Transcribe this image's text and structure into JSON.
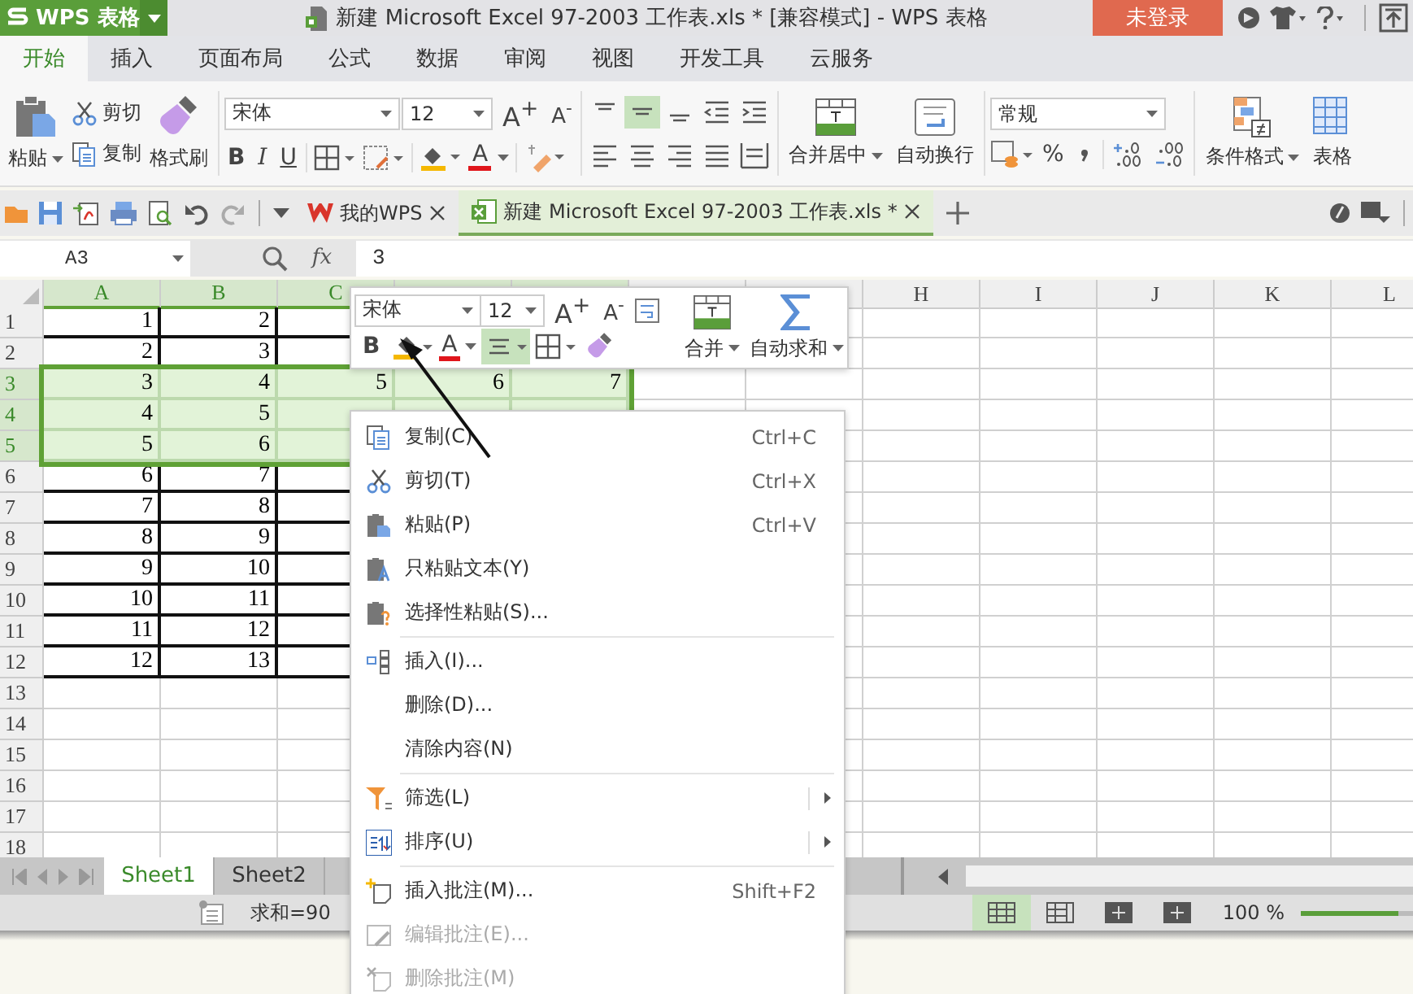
{
  "app_menu": {
    "label": "WPS 表格"
  },
  "window": {
    "title": "新建 Microsoft Excel 97-2003 工作表.xls * [兼容模式] - WPS 表格"
  },
  "account": {
    "label": "未登录"
  },
  "ribbon_tabs": [
    {
      "label": "开始",
      "selected": true
    },
    {
      "label": "插入",
      "selected": false
    },
    {
      "label": "页面布局",
      "selected": false
    },
    {
      "label": "公式",
      "selected": false
    },
    {
      "label": "数据",
      "selected": false
    },
    {
      "label": "审阅",
      "selected": false
    },
    {
      "label": "视图",
      "selected": false
    },
    {
      "label": "开发工具",
      "selected": false
    },
    {
      "label": "云服务",
      "selected": false
    }
  ],
  "ribbon": {
    "paste": "粘贴",
    "cut": "剪切",
    "copy": "复制",
    "format_painter": "格式刷",
    "font": "宋体",
    "font_size": "12",
    "grow_font": "A$^{+}$",
    "shrink_font": "A$^{-}$",
    "bold": "B",
    "italic": "I",
    "underline": "U",
    "font_color": "A",
    "vertical_align": [
      {
        "selected": false
      },
      {
        "selected": true
      },
      {
        "selected": false
      }
    ],
    "merge": "合并居中",
    "wrap_text": "自动换行",
    "number_format": "常规",
    "percent": "%",
    "conditional_format": "条件格式",
    "table_format": "表格"
  },
  "doc_tabs": [
    {
      "label": "我的WPS",
      "selected": false
    },
    {
      "label": "新建 Microsoft Excel 97-2003 工作表.xls *",
      "selected": true
    }
  ],
  "formula_bar": {
    "name_box": "A3",
    "fx": "fx",
    "value": "3"
  },
  "sheet": {
    "columns": [
      {
        "label": "A",
        "selected": true
      },
      {
        "label": "B",
        "selected": true
      },
      {
        "label": "C",
        "selected": true
      },
      {
        "selected": true
      },
      {
        "selected": true
      },
      {
        "selected": false
      },
      {
        "selected": false
      },
      {
        "label": "H",
        "selected": false
      },
      {
        "label": "I",
        "selected": false
      },
      {
        "label": "J",
        "selected": false
      },
      {
        "label": "K",
        "selected": false
      },
      {
        "label": "L",
        "selected": false
      }
    ],
    "rows": [
      {
        "label": "1",
        "selected": false,
        "bordered": true,
        "cells": [
          "1",
          "2"
        ]
      },
      {
        "label": "2",
        "selected": false,
        "bordered": true,
        "cells": [
          "2",
          "3"
        ]
      },
      {
        "label": "3",
        "selected": true,
        "bordered": true,
        "cells": [
          "3",
          "4",
          "5",
          "6",
          "7"
        ]
      },
      {
        "label": "4",
        "selected": true,
        "bordered": true,
        "cells": [
          "4",
          "5"
        ]
      },
      {
        "label": "5",
        "selected": true,
        "bordered": true,
        "cells": [
          "5",
          "6"
        ]
      },
      {
        "label": "6",
        "selected": false,
        "bordered": true,
        "cells": [
          "6",
          "7"
        ]
      },
      {
        "label": "7",
        "selected": false,
        "bordered": true,
        "cells": [
          "7",
          "8"
        ]
      },
      {
        "label": "8",
        "selected": false,
        "bordered": true,
        "cells": [
          "8",
          "9"
        ]
      },
      {
        "label": "9",
        "selected": false,
        "bordered": true,
        "cells": [
          "9",
          "10"
        ]
      },
      {
        "label": "10",
        "selected": false,
        "bordered": true,
        "cells": [
          "10",
          "11"
        ]
      },
      {
        "label": "11",
        "selected": false,
        "bordered": true,
        "cells": [
          "11",
          "12"
        ]
      },
      {
        "label": "12",
        "selected": false,
        "bordered": true,
        "cells": [
          "12",
          "13"
        ]
      },
      {
        "label": "13",
        "selected": false,
        "bordered": false
      },
      {
        "label": "14",
        "selected": false,
        "bordered": false
      },
      {
        "label": "15",
        "selected": false,
        "bordered": false
      },
      {
        "label": "16",
        "selected": false,
        "bordered": false
      },
      {
        "label": "17",
        "selected": false,
        "bordered": false
      },
      {
        "label": "18",
        "selected": false,
        "bordered": false
      }
    ]
  },
  "mini_toolbar": {
    "font": "宋体",
    "font_size": "12",
    "grow_font": "A$^{+}$",
    "shrink_font": "A$^{-}$",
    "bold": "B",
    "font_color": "A",
    "align_center_selected": true,
    "merge": "合并",
    "autosum": "自动求和"
  },
  "context_menu": {
    "groups": [
      [
        {
          "label": "复制(C)",
          "shortcut": "Ctrl+C",
          "disabled": false,
          "submenu": false
        },
        {
          "label": "剪切(T)",
          "shortcut": "Ctrl+X",
          "disabled": false,
          "submenu": false
        },
        {
          "label": "粘贴(P)",
          "shortcut": "Ctrl+V",
          "disabled": false,
          "submenu": false
        },
        {
          "label": "只粘贴文本(Y)",
          "disabled": false,
          "submenu": false
        },
        {
          "label": "选择性粘贴(S)...",
          "disabled": false,
          "submenu": false
        }
      ],
      [
        {
          "label": "插入(I)...",
          "disabled": false,
          "submenu": false
        },
        {
          "label": "删除(D)...",
          "disabled": false,
          "submenu": false
        },
        {
          "label": "清除内容(N)",
          "disabled": false,
          "submenu": false
        }
      ],
      [
        {
          "label": "筛选(L)",
          "disabled": false,
          "submenu": true
        },
        {
          "label": "排序(U)",
          "disabled": false,
          "submenu": true
        }
      ],
      [
        {
          "label": "插入批注(M)...",
          "shortcut": "Shift+F2",
          "disabled": false,
          "submenu": false
        },
        {
          "label": "编辑批注(E)...",
          "disabled": true,
          "submenu": false
        },
        {
          "label": "删除批注(M)",
          "disabled": true,
          "submenu": false
        }
      ]
    ]
  },
  "sheet_tabs": [
    {
      "label": "Sheet1",
      "selected": true
    },
    {
      "label": "Sheet2",
      "selected": false
    }
  ],
  "status_bar": {
    "sum": "求和=90",
    "views": [
      {
        "selected": true
      },
      {
        "selected": false
      },
      {
        "selected": false
      },
      {
        "selected": false
      }
    ],
    "zoom": "100 %",
    "zoom_slider": {
      "level": 0.5
    }
  }
}
